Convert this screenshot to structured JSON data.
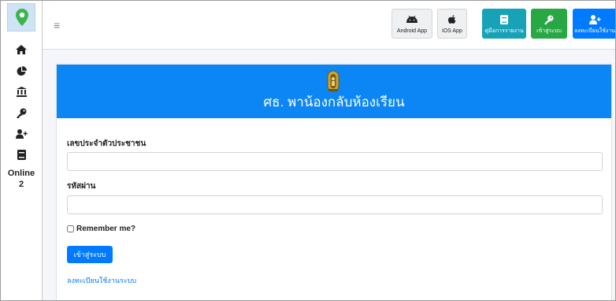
{
  "sidebar": {
    "logo_icon": "map-pin-logo",
    "icons": [
      "home-icon",
      "chart-pie-icon",
      "bank-icon",
      "key-icon",
      "user-plus-icon",
      "book-icon"
    ],
    "online_label": "Online",
    "online_count": "2"
  },
  "navbar": {
    "menu_icon": "≡",
    "buttons": [
      {
        "label": "Android App",
        "icon": "android-icon",
        "style": "light"
      },
      {
        "label": "iOS App",
        "icon": "apple-icon",
        "style": "light"
      },
      {
        "label": "คู่มือการรายงาน",
        "icon": "book-icon",
        "style": "teal"
      },
      {
        "label": "เข้าสู่ระบบ",
        "icon": "key-icon",
        "style": "green"
      },
      {
        "label": "ลงทะเบียนใช้งาน",
        "icon": "user-plus-icon",
        "style": "blue"
      }
    ]
  },
  "card": {
    "title": "ศธ. พาน้องกลับห้องเรียน",
    "id_label": "เลขประจำตัวประชาชน",
    "id_value": "",
    "password_label": "รหัสผ่าน",
    "password_value": "",
    "remember_label": "Remember me?",
    "remember_checked": false,
    "login_button": "เข้าสู่ระบบ",
    "register_link": "ลงทะเบียนใช้งานระบบ"
  },
  "colors": {
    "header_blue": "#0d86f5",
    "primary": "#007bff",
    "teal": "#17a2b8",
    "green": "#28a745"
  }
}
